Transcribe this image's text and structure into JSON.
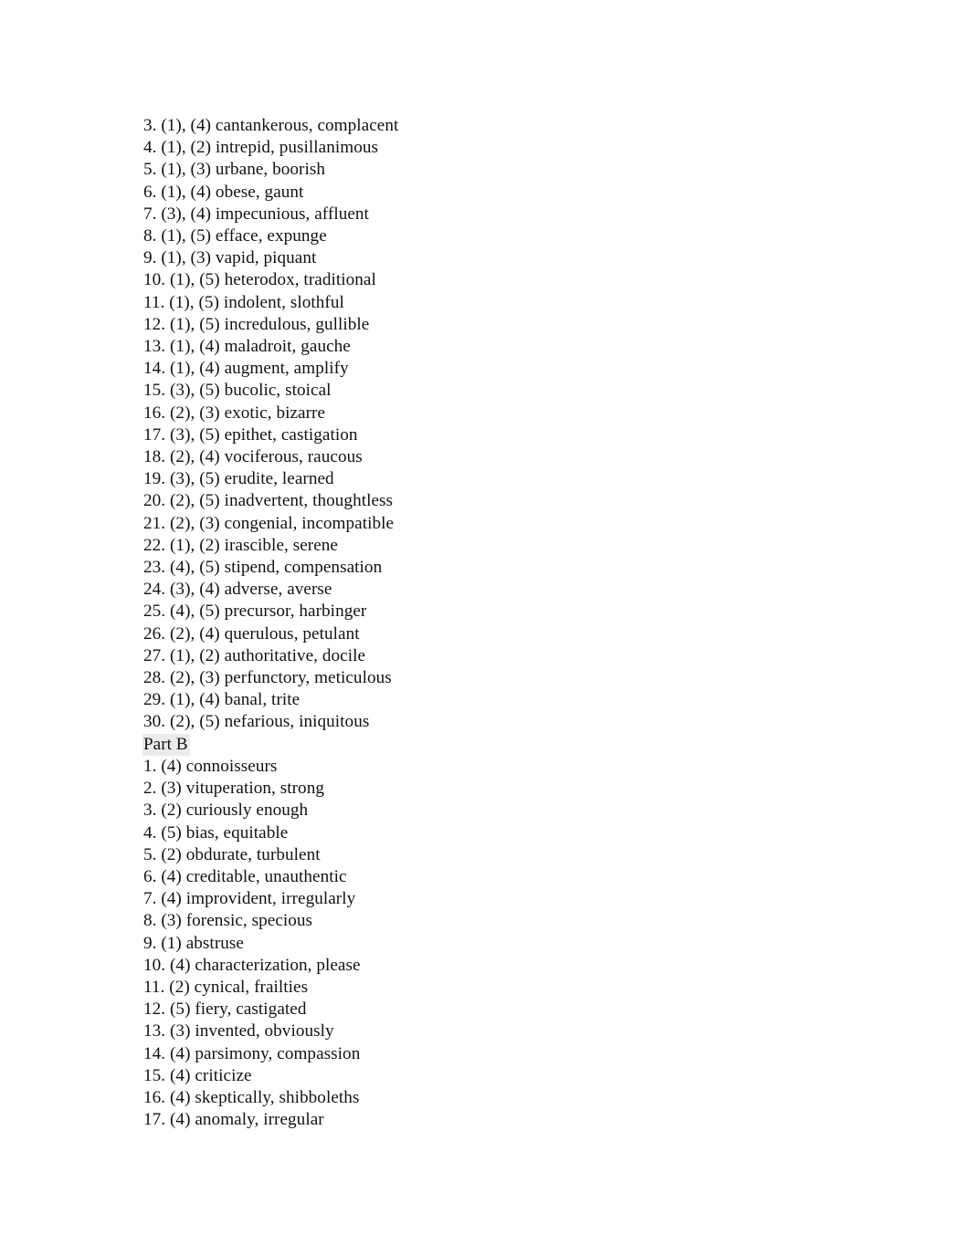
{
  "document": {
    "background_color": "#ffffff",
    "text_color": "#131313",
    "highlight_color": "#ebebeb"
  },
  "part_a": {
    "lines": [
      "3. (1), (4) cantankerous, complacent",
      "4. (1), (2) intrepid, pusillanimous",
      "5. (1), (3) urbane, boorish",
      "6. (1), (4) obese, gaunt",
      "7. (3), (4) impecunious, affluent",
      "8. (1), (5) efface, expunge",
      "9. (1), (3) vapid, piquant",
      "10. (1), (5) heterodox, traditional",
      "11. (1), (5) indolent, slothful",
      "12. (1), (5) incredulous, gullible",
      "13. (1), (4) maladroit, gauche",
      "14. (1), (4) augment, amplify",
      "15. (3), (5) bucolic, stoical",
      "16. (2), (3) exotic, bizarre",
      "17. (3), (5) epithet, castigation",
      "18. (2), (4) vociferous, raucous",
      "19. (3), (5) erudite, learned",
      "20. (2), (5) inadvertent, thoughtless",
      "21. (2), (3) congenial, incompatible",
      "22. (1), (2) irascible, serene",
      "23. (4), (5) stipend, compensation",
      "24. (3), (4) adverse, averse",
      "25. (4), (5) precursor, harbinger",
      "26. (2), (4) querulous, petulant",
      "27. (1), (2) authoritative, docile",
      "28. (2), (3) perfunctory, meticulous",
      "29. (1), (4) banal, trite",
      "30. (2), (5) nefarious, iniquitous"
    ]
  },
  "part_b": {
    "heading": "Part B",
    "lines": [
      "1. (4) connoisseurs",
      "2. (3) vituperation, strong",
      "3. (2) curiously enough",
      "4. (5) bias, equitable",
      "5. (2) obdurate, turbulent",
      "6. (4) creditable, unauthentic",
      "7. (4) improvident, irregularly",
      "8. (3) forensic, specious",
      "9. (1) abstruse",
      "10. (4) characterization, please",
      "11. (2) cynical, frailties",
      "12. (5) fiery, castigated",
      "13. (3) invented, obviously",
      "14. (4) parsimony, compassion",
      "15. (4) criticize",
      "16. (4) skeptically, shibboleths",
      "17. (4) anomaly, irregular"
    ]
  }
}
